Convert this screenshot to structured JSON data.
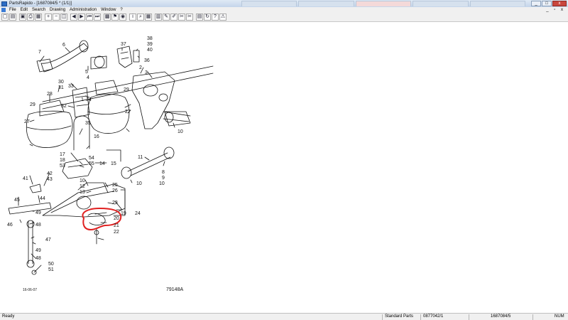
{
  "window": {
    "title": "PartsRapido - [1687084/5 * (1/1)]",
    "controls": [
      "_",
      "□",
      "x"
    ]
  },
  "menu": {
    "items": [
      "File",
      "Edit",
      "Search",
      "Drawing",
      "Administration",
      "Window",
      "?"
    ],
    "right": "_ ▫ x"
  },
  "toolbar": {
    "icons": [
      "new-icon",
      "open-icon",
      "save-icon",
      "print-icon",
      "preview-icon",
      "zoom-in-icon",
      "zoom-out-icon",
      "zoom-fit-icon",
      "back-icon",
      "forward-icon",
      "first-icon",
      "last-icon",
      "cart-icon",
      "flag-icon",
      "globe-icon",
      "info-icon",
      "search-icon",
      "grid-icon",
      "book-icon",
      "tools-icon",
      "edit-icon",
      "cut-icon",
      "scissors-icon",
      "notes-icon",
      "refresh-icon",
      "help-icon",
      "warning-icon"
    ],
    "glyphs": [
      "▢",
      "▤",
      "▣",
      "⎙",
      "▦",
      "+",
      "−",
      "◫",
      "◀",
      "▶",
      "⏮",
      "⏭",
      "▩",
      "⚑",
      "◉",
      "i",
      "⌕",
      "▦",
      "▥",
      "✎",
      "✐",
      "✂",
      "✂",
      "▤",
      "↻",
      "?",
      "⚠"
    ]
  },
  "drawing": {
    "callouts": [
      {
        "id": "c1",
        "text": "7"
      },
      {
        "id": "c2",
        "text": "6"
      },
      {
        "id": "c3",
        "text": "5"
      },
      {
        "id": "c4",
        "text": "4"
      },
      {
        "id": "c5",
        "text": "37"
      },
      {
        "id": "c6",
        "text": "38"
      },
      {
        "id": "c7",
        "text": "39"
      },
      {
        "id": "c8",
        "text": "40"
      },
      {
        "id": "c9",
        "text": "36"
      },
      {
        "id": "c10",
        "text": "2"
      },
      {
        "id": "c11",
        "text": "3"
      },
      {
        "id": "c12",
        "text": "30"
      },
      {
        "id": "c13",
        "text": "31"
      },
      {
        "id": "c14",
        "text": "28"
      },
      {
        "id": "c15",
        "text": "29"
      },
      {
        "id": "c16",
        "text": "33"
      },
      {
        "id": "c17",
        "text": "32"
      },
      {
        "id": "c18",
        "text": "34"
      },
      {
        "id": "c19",
        "text": "1"
      },
      {
        "id": "c20",
        "text": "29"
      },
      {
        "id": "c21",
        "text": "27"
      },
      {
        "id": "c22",
        "text": "27"
      },
      {
        "id": "c23",
        "text": "35"
      },
      {
        "id": "c24",
        "text": "16"
      },
      {
        "id": "c25",
        "text": "10"
      },
      {
        "id": "c26",
        "text": "17"
      },
      {
        "id": "c27",
        "text": "18"
      },
      {
        "id": "c28",
        "text": "53"
      },
      {
        "id": "c29",
        "text": "54"
      },
      {
        "id": "c30",
        "text": "55"
      },
      {
        "id": "c31",
        "text": "14"
      },
      {
        "id": "c32",
        "text": "15"
      },
      {
        "id": "c33",
        "text": "11"
      },
      {
        "id": "c34",
        "text": "8"
      },
      {
        "id": "c35",
        "text": "9"
      },
      {
        "id": "c36",
        "text": "10"
      },
      {
        "id": "c37",
        "text": "10"
      },
      {
        "id": "c38",
        "text": "41"
      },
      {
        "id": "c39",
        "text": "42"
      },
      {
        "id": "c40",
        "text": "43"
      },
      {
        "id": "c41",
        "text": "10"
      },
      {
        "id": "c42",
        "text": "12"
      },
      {
        "id": "c43",
        "text": "13"
      },
      {
        "id": "c44",
        "text": "25"
      },
      {
        "id": "c45",
        "text": "26"
      },
      {
        "id": "c46",
        "text": "44"
      },
      {
        "id": "c47",
        "text": "45"
      },
      {
        "id": "c48",
        "text": "23"
      },
      {
        "id": "c49",
        "text": "19"
      },
      {
        "id": "c50",
        "text": "24"
      },
      {
        "id": "c51",
        "text": "49"
      },
      {
        "id": "c52",
        "text": "46"
      },
      {
        "id": "c53",
        "text": "48"
      },
      {
        "id": "c54",
        "text": "20"
      },
      {
        "id": "c55",
        "text": "21"
      },
      {
        "id": "c56",
        "text": "22"
      },
      {
        "id": "c57",
        "text": "47"
      },
      {
        "id": "c58",
        "text": "49"
      },
      {
        "id": "c59",
        "text": "48"
      },
      {
        "id": "c60",
        "text": "50"
      },
      {
        "id": "c61",
        "text": "51"
      }
    ],
    "date": "16-06-07",
    "drawing_number": "79148A"
  },
  "status": {
    "left": "Ready",
    "mode": "Standard Parts",
    "part_number": "0877042/1",
    "document": "1687084/5",
    "keyboard": "NUM"
  }
}
